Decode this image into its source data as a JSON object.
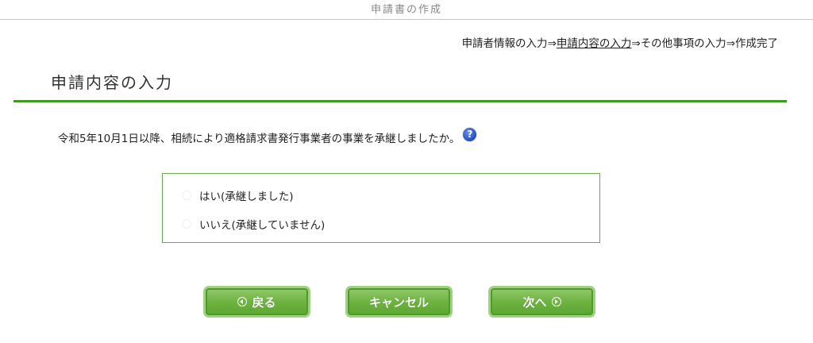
{
  "header": {
    "title": "申請書の作成"
  },
  "steps": {
    "step1": "申請者情報の入力",
    "arrow": "⇒",
    "step2": "申請内容の入力",
    "step3": "その他事項の入力",
    "step4": "作成完了"
  },
  "section": {
    "title": "申請内容の入力"
  },
  "question": {
    "text": "令和5年10月1日以降、相続により適格請求書発行事業者の事業を承継しましたか。",
    "help_icon": "?"
  },
  "options": [
    {
      "label": "はい(承継しました)"
    },
    {
      "label": "いいえ(承継していません)"
    }
  ],
  "buttons": {
    "back": "戻る",
    "cancel": "キャンセル",
    "next": "次へ"
  },
  "colors": {
    "accent_green": "#3f9a23",
    "button_green": "#6fb342",
    "help_blue": "#2b56c9"
  }
}
